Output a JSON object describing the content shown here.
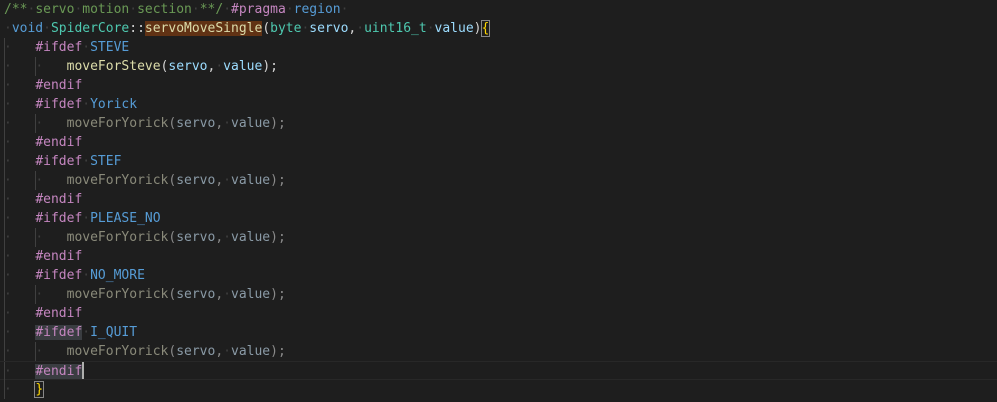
{
  "editor": {
    "lines": [
      {
        "indent": 0,
        "tokens": [
          {
            "t": "/**",
            "c": "c-comment"
          },
          {
            "t": "·",
            "c": "dot"
          },
          {
            "t": "servo",
            "c": "c-comment"
          },
          {
            "t": "·",
            "c": "dot"
          },
          {
            "t": "motion",
            "c": "c-comment"
          },
          {
            "t": "·",
            "c": "dot"
          },
          {
            "t": "section",
            "c": "c-comment"
          },
          {
            "t": "·",
            "c": "dot"
          },
          {
            "t": "**/",
            "c": "c-comment"
          },
          {
            "t": "·",
            "c": "dot"
          },
          {
            "t": "#pragma",
            "c": "c-pp"
          },
          {
            "t": "·",
            "c": "dot"
          },
          {
            "t": "region",
            "c": "c-macro"
          },
          {
            "t": "·",
            "c": "dot"
          }
        ]
      },
      {
        "indent": 0,
        "tokens": [
          {
            "t": "·",
            "c": "dot"
          },
          {
            "t": "void",
            "c": "c-keyword"
          },
          {
            "t": "·",
            "c": "dot"
          },
          {
            "t": "SpiderCore",
            "c": "c-type"
          },
          {
            "t": "::",
            "c": "c-text"
          },
          {
            "t": "servoMoveSingle",
            "c": "c-func hl-word"
          },
          {
            "t": "(",
            "c": "c-text"
          },
          {
            "t": "byte",
            "c": "c-type"
          },
          {
            "t": "·",
            "c": "dot"
          },
          {
            "t": "servo",
            "c": "c-var"
          },
          {
            "t": ",",
            "c": "c-text"
          },
          {
            "t": "·",
            "c": "dot"
          },
          {
            "t": "uint16_t",
            "c": "c-type"
          },
          {
            "t": "·",
            "c": "dot"
          },
          {
            "t": "value",
            "c": "c-var"
          },
          {
            "t": ")",
            "c": "c-text"
          },
          {
            "t": "{",
            "c": "c-brace brace-box"
          }
        ]
      },
      {
        "indent": 1,
        "tokens": [
          {
            "t": "#ifdef",
            "c": "c-pp"
          },
          {
            "t": "·",
            "c": "dot"
          },
          {
            "t": "STEVE",
            "c": "c-macro"
          }
        ]
      },
      {
        "indent": 2,
        "tokens": [
          {
            "t": "moveForSteve",
            "c": "c-func"
          },
          {
            "t": "(",
            "c": "c-text"
          },
          {
            "t": "servo",
            "c": "c-var"
          },
          {
            "t": ",",
            "c": "c-text"
          },
          {
            "t": "·",
            "c": "dot"
          },
          {
            "t": "value",
            "c": "c-var"
          },
          {
            "t": ");",
            "c": "c-text"
          }
        ]
      },
      {
        "indent": 1,
        "tokens": [
          {
            "t": "#endif",
            "c": "c-pp"
          }
        ]
      },
      {
        "indent": 1,
        "tokens": [
          {
            "t": "#ifdef",
            "c": "c-pp"
          },
          {
            "t": "·",
            "c": "dot"
          },
          {
            "t": "Yorick",
            "c": "c-macro"
          }
        ]
      },
      {
        "indent": 2,
        "tokens": [
          {
            "t": "moveForYorick",
            "c": "c-func-dim"
          },
          {
            "t": "(",
            "c": "c-dim"
          },
          {
            "t": "servo",
            "c": "c-var-dim"
          },
          {
            "t": ",",
            "c": "c-dim"
          },
          {
            "t": "·",
            "c": "dot"
          },
          {
            "t": "value",
            "c": "c-var-dim"
          },
          {
            "t": ");",
            "c": "c-dim"
          }
        ]
      },
      {
        "indent": 1,
        "tokens": [
          {
            "t": "#endif",
            "c": "c-pp"
          }
        ]
      },
      {
        "indent": 1,
        "tokens": [
          {
            "t": "#ifdef",
            "c": "c-pp"
          },
          {
            "t": "·",
            "c": "dot"
          },
          {
            "t": "STEF",
            "c": "c-macro"
          }
        ]
      },
      {
        "indent": 2,
        "tokens": [
          {
            "t": "moveForYorick",
            "c": "c-func-dim"
          },
          {
            "t": "(",
            "c": "c-dim"
          },
          {
            "t": "servo",
            "c": "c-var-dim"
          },
          {
            "t": ",",
            "c": "c-dim"
          },
          {
            "t": "·",
            "c": "dot"
          },
          {
            "t": "value",
            "c": "c-var-dim"
          },
          {
            "t": ");",
            "c": "c-dim"
          }
        ]
      },
      {
        "indent": 1,
        "tokens": [
          {
            "t": "#endif",
            "c": "c-pp"
          }
        ]
      },
      {
        "indent": 1,
        "tokens": [
          {
            "t": "#ifdef",
            "c": "c-pp"
          },
          {
            "t": "·",
            "c": "dot"
          },
          {
            "t": "PLEASE_NO",
            "c": "c-macro"
          }
        ]
      },
      {
        "indent": 2,
        "tokens": [
          {
            "t": "moveForYorick",
            "c": "c-func-dim"
          },
          {
            "t": "(",
            "c": "c-dim"
          },
          {
            "t": "servo",
            "c": "c-var-dim"
          },
          {
            "t": ",",
            "c": "c-dim"
          },
          {
            "t": "·",
            "c": "dot"
          },
          {
            "t": "value",
            "c": "c-var-dim"
          },
          {
            "t": ");",
            "c": "c-dim"
          }
        ]
      },
      {
        "indent": 1,
        "tokens": [
          {
            "t": "#endif",
            "c": "c-pp"
          }
        ]
      },
      {
        "indent": 1,
        "tokens": [
          {
            "t": "#ifdef",
            "c": "c-pp"
          },
          {
            "t": "·",
            "c": "dot"
          },
          {
            "t": "NO_MORE",
            "c": "c-macro"
          }
        ]
      },
      {
        "indent": 2,
        "tokens": [
          {
            "t": "moveForYorick",
            "c": "c-func-dim"
          },
          {
            "t": "(",
            "c": "c-dim"
          },
          {
            "t": "servo",
            "c": "c-var-dim"
          },
          {
            "t": ",",
            "c": "c-dim"
          },
          {
            "t": "·",
            "c": "dot"
          },
          {
            "t": "value",
            "c": "c-var-dim"
          },
          {
            "t": ");",
            "c": "c-dim"
          }
        ]
      },
      {
        "indent": 1,
        "tokens": [
          {
            "t": "#endif",
            "c": "c-pp"
          }
        ]
      },
      {
        "indent": 1,
        "tokens": [
          {
            "t": "#ifdef",
            "c": "c-pp hl-pp"
          },
          {
            "t": "·",
            "c": "dot"
          },
          {
            "t": "I_QUIT",
            "c": "c-macro"
          }
        ]
      },
      {
        "indent": 2,
        "tokens": [
          {
            "t": "moveForYorick",
            "c": "c-func-dim"
          },
          {
            "t": "(",
            "c": "c-dim"
          },
          {
            "t": "servo",
            "c": "c-var-dim"
          },
          {
            "t": ",",
            "c": "c-dim"
          },
          {
            "t": "·",
            "c": "dot"
          },
          {
            "t": "value",
            "c": "c-var-dim"
          },
          {
            "t": ");",
            "c": "c-dim"
          }
        ]
      },
      {
        "indent": 1,
        "current": true,
        "tokens": [
          {
            "t": "#endif",
            "c": "c-pp hl-pp"
          }
        ]
      },
      {
        "indent": 1,
        "tokens": [
          {
            "t": "}",
            "c": "c-brace brace-box"
          }
        ]
      }
    ]
  }
}
